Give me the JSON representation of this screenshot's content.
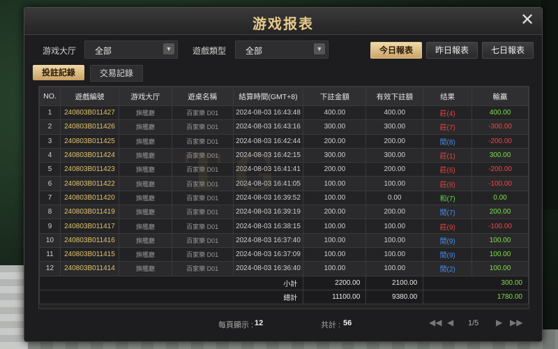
{
  "title": "游戏报表",
  "filters": {
    "hall_label": "游戏大厅",
    "hall_value": "全部",
    "type_label": "遊戲類型",
    "type_value": "全部"
  },
  "date_buttons": {
    "today": "今日報表",
    "yesterday": "昨日報表",
    "week": "七日報表"
  },
  "tabs": {
    "bets": "投註記錄",
    "transactions": "交易記錄"
  },
  "columns": [
    "NO.",
    "遊戲編號",
    "游戏大厅",
    "遊桌名稱",
    "結算時間(GMT+8)",
    "下註金額",
    "有效下註額",
    "结果",
    "輸贏"
  ],
  "rows": [
    {
      "no": "1",
      "id": "240803B011427",
      "hall": "旗艦廳",
      "table": "百家樂 D01",
      "time": "2024-08-03 16:43:48",
      "bet": "400.00",
      "valid": "400.00",
      "result": "莊(4)",
      "rc": "red",
      "wl": "400.00",
      "wc": "pos"
    },
    {
      "no": "2",
      "id": "240803B011426",
      "hall": "旗艦廳",
      "table": "百家樂 D01",
      "time": "2024-08-03 16:43:16",
      "bet": "300.00",
      "valid": "300.00",
      "result": "莊(7)",
      "rc": "red",
      "wl": "-300.00",
      "wc": "neg"
    },
    {
      "no": "3",
      "id": "240803B011425",
      "hall": "旗艦廳",
      "table": "百家樂 D01",
      "time": "2024-08-03 16:42:44",
      "bet": "200.00",
      "valid": "200.00",
      "result": "閒(8)",
      "rc": "blue",
      "wl": "-200.00",
      "wc": "neg"
    },
    {
      "no": "4",
      "id": "240803B011424",
      "hall": "旗艦廳",
      "table": "百家樂 D01",
      "time": "2024-08-03 16:42:15",
      "bet": "300.00",
      "valid": "300.00",
      "result": "莊(1)",
      "rc": "red",
      "wl": "300.00",
      "wc": "pos"
    },
    {
      "no": "5",
      "id": "240803B011423",
      "hall": "旗艦廳",
      "table": "百家樂 D01",
      "time": "2024-08-03 16:41:41",
      "bet": "200.00",
      "valid": "200.00",
      "result": "莊(6)",
      "rc": "red",
      "wl": "-200.00",
      "wc": "neg"
    },
    {
      "no": "6",
      "id": "240803B011422",
      "hall": "旗艦廳",
      "table": "百家樂 D01",
      "time": "2024-08-03 16:41:05",
      "bet": "100.00",
      "valid": "100.00",
      "result": "莊(8)",
      "rc": "red",
      "wl": "-100.00",
      "wc": "neg"
    },
    {
      "no": "7",
      "id": "240803B011420",
      "hall": "旗艦廳",
      "table": "百家樂 D01",
      "time": "2024-08-03 16:39:52",
      "bet": "100.00",
      "valid": "0.00",
      "result": "和(7)",
      "rc": "green",
      "wl": "0.00",
      "wc": "zero"
    },
    {
      "no": "8",
      "id": "240803B011419",
      "hall": "旗艦廳",
      "table": "百家樂 D01",
      "time": "2024-08-03 16:39:19",
      "bet": "200.00",
      "valid": "200.00",
      "result": "閒(7)",
      "rc": "blue",
      "wl": "200.00",
      "wc": "pos"
    },
    {
      "no": "9",
      "id": "240803B011417",
      "hall": "旗艦廳",
      "table": "百家樂 D01",
      "time": "2024-08-03 16:38:15",
      "bet": "100.00",
      "valid": "100.00",
      "result": "莊(9)",
      "rc": "red",
      "wl": "-100.00",
      "wc": "neg"
    },
    {
      "no": "10",
      "id": "240803B011416",
      "hall": "旗艦廳",
      "table": "百家樂 D01",
      "time": "2024-08-03 16:37:40",
      "bet": "100.00",
      "valid": "100.00",
      "result": "閒(9)",
      "rc": "blue",
      "wl": "100.00",
      "wc": "pos"
    },
    {
      "no": "11",
      "id": "240803B011415",
      "hall": "旗艦廳",
      "table": "百家樂 D01",
      "time": "2024-08-03 16:37:09",
      "bet": "100.00",
      "valid": "100.00",
      "result": "閒(9)",
      "rc": "blue",
      "wl": "100.00",
      "wc": "pos"
    },
    {
      "no": "12",
      "id": "240803B011414",
      "hall": "旗艦廳",
      "table": "百家樂 D01",
      "time": "2024-08-03 16:36:40",
      "bet": "100.00",
      "valid": "100.00",
      "result": "閒(2)",
      "rc": "blue",
      "wl": "100.00",
      "wc": "pos"
    }
  ],
  "subtotal": {
    "label": "小計",
    "bet": "2200.00",
    "valid": "2100.00",
    "wl": "300.00"
  },
  "total": {
    "label": "總計",
    "bet": "11100.00",
    "valid": "9380.00",
    "wl": "1780.00"
  },
  "pager": {
    "per_page_label": "每頁顯示 :",
    "per_page_value": "12",
    "total_label": "共計 :",
    "total_value": "56",
    "page": "1/5"
  },
  "watermark": "TG"
}
